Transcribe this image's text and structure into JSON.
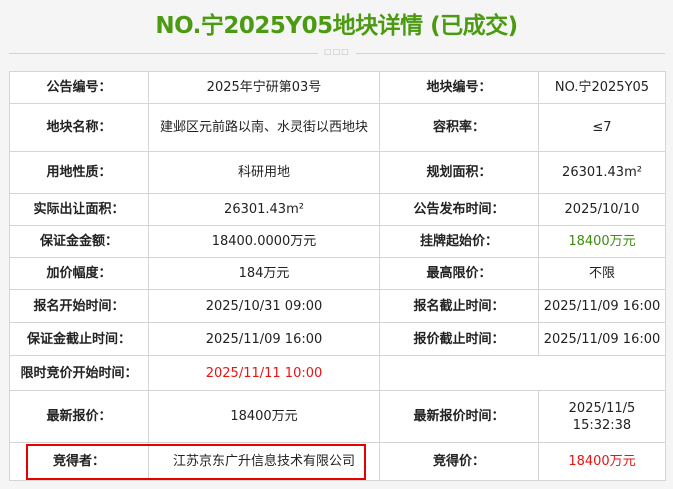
{
  "title": "NO.宁2025Y05地块详情 (已成交)",
  "divider_glyph": "□□□",
  "rows": [
    {
      "k1": "公告编号：",
      "v1": "2025年宁研第03号",
      "k2": "地块编号：",
      "v2": "NO.宁2025Y05"
    },
    {
      "k1": "地块名称：",
      "v1": "建邺区元前路以南、水灵街以西地块",
      "k2": "容积率：",
      "v2": "≤7"
    },
    {
      "k1": "用地性质：",
      "v1": "科研用地",
      "k2": "规划面积：",
      "v2": "26301.43m²"
    },
    {
      "k1": "实际出让面积：",
      "v1": "26301.43m²",
      "k2": "公告发布时间：",
      "v2": "2025/10/10"
    },
    {
      "k1": "保证金金额：",
      "v1": "18400.0000万元",
      "k2": "挂牌起始价：",
      "v2": "18400万元"
    },
    {
      "k1": "加价幅度：",
      "v1": "184万元",
      "k2": "最高限价：",
      "v2": "不限"
    },
    {
      "k1": "报名开始时间：",
      "v1": "2025/10/31 09:00",
      "k2": "报名截止时间：",
      "v2": "2025/11/09 16:00"
    },
    {
      "k1": "保证金截止时间：",
      "v1": "2025/11/09 16:00",
      "k2": "报价截止时间：",
      "v2": "2025/11/09 16:00"
    },
    {
      "k1": "限时竞价开始时间：",
      "v1": "2025/11/11 10:00"
    },
    {
      "k1": "最新报价：",
      "v1": "18400万元",
      "k2": "最新报价时间：",
      "v2a": "2025/11/5",
      "v2b": "15:32:38"
    },
    {
      "k1": "竞得者：",
      "v1": "江苏京东广升信息技术有限公司",
      "k2": "竞得价：",
      "v2": "18400万元"
    }
  ],
  "colors": {
    "title": "#4b9a12",
    "highlight": "#e60000",
    "red_value": "#e81414",
    "green_value": "#3e8c0b"
  }
}
